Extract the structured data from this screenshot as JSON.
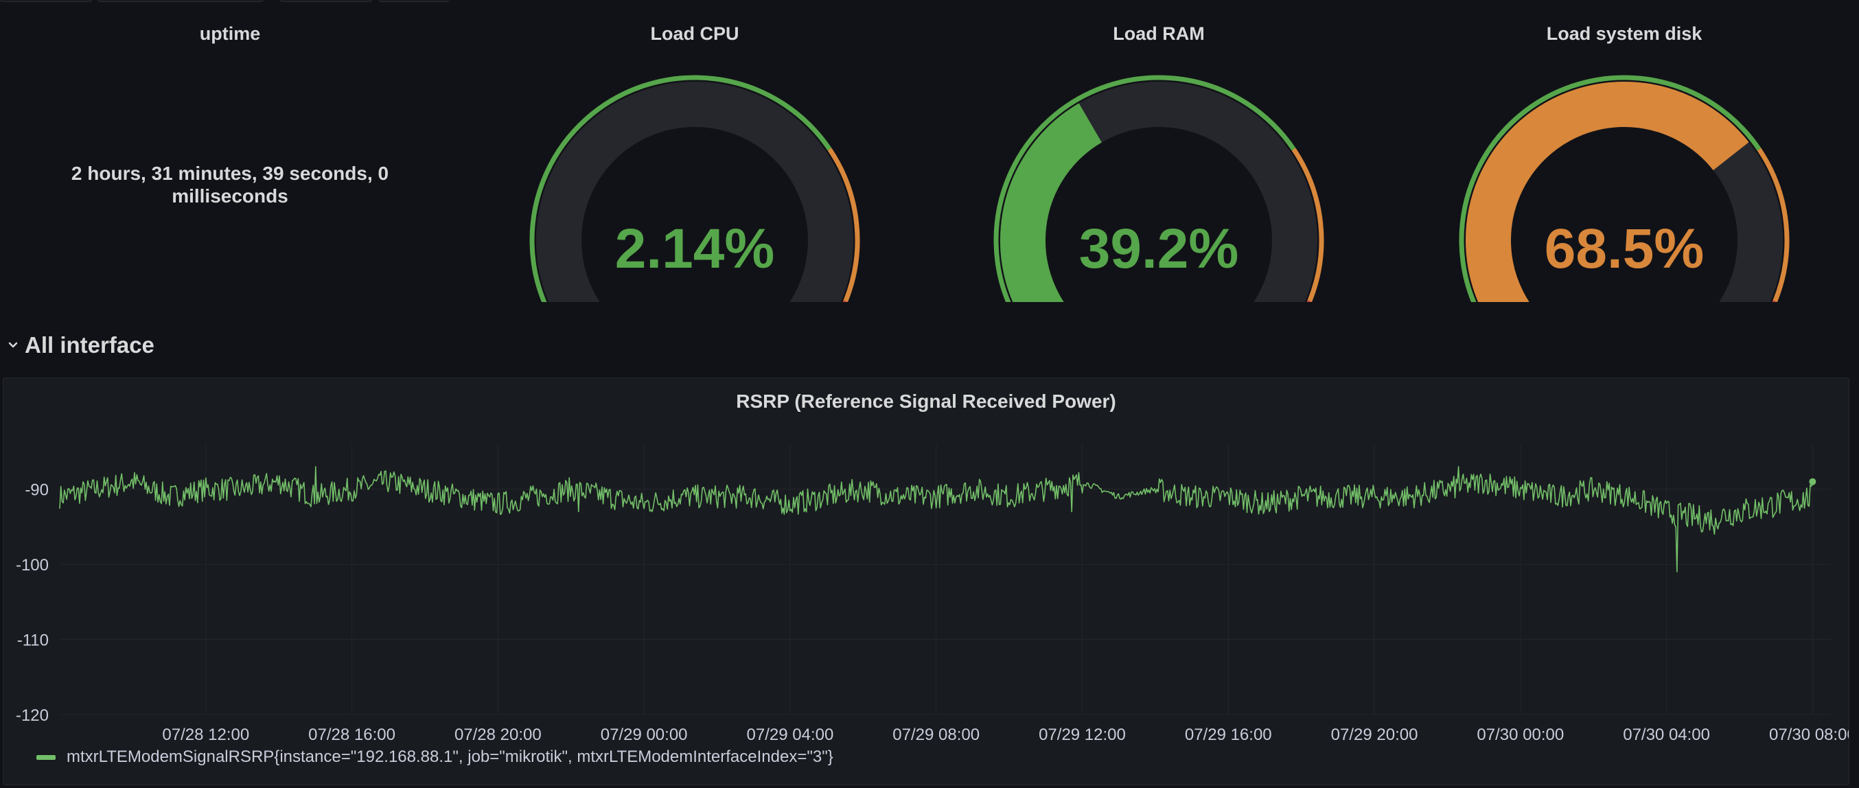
{
  "colors": {
    "background": "#111217",
    "panel": "#181b1f",
    "green": "#56a64b",
    "orange": "#d8873b",
    "red": "#c4413e",
    "series": "#73bf69"
  },
  "uptime": {
    "title": "uptime",
    "value": "2 hours, 31 minutes, 39 seconds, 0 milliseconds"
  },
  "gauges": [
    {
      "title": "Load CPU",
      "value": 2.14,
      "display": "2.14%",
      "color": "#56a64b"
    },
    {
      "title": "Load RAM",
      "value": 39.2,
      "display": "39.2%",
      "color": "#56a64b"
    },
    {
      "title": "Load system disk",
      "value": 68.5,
      "display": "68.5%",
      "color": "#d8873b"
    }
  ],
  "row": {
    "title": "All interface",
    "icon": "chevron-down-icon"
  },
  "chart_data": {
    "type": "line",
    "title": "RSRP (Reference Signal Received Power)",
    "x_ticks": [
      "07/28 12:00",
      "07/28 16:00",
      "07/28 20:00",
      "07/29 00:00",
      "07/29 04:00",
      "07/29 08:00",
      "07/29 12:00",
      "07/29 16:00",
      "07/29 20:00",
      "07/30 00:00",
      "07/30 04:00",
      "07/30 08:00"
    ],
    "y_ticks": [
      -90,
      -100,
      -110,
      -120
    ],
    "ylim": [
      -120,
      -84
    ],
    "grid": true,
    "legend_position": "bottom-left",
    "series": [
      {
        "name": "mtxrLTEModemSignalRSRP{instance=\"192.168.88.1\", job=\"mikrotik\", mtxrLTEModemInterfaceIndex=\"3\"}",
        "color": "#73bf69",
        "x_hours": [
          0,
          1,
          2,
          3,
          4,
          5,
          6,
          7,
          8,
          9,
          10,
          11,
          12,
          13,
          14,
          15,
          16,
          17,
          18,
          19,
          20,
          21,
          22,
          23,
          24,
          25,
          26,
          27,
          28,
          29,
          30,
          31,
          32,
          33,
          34,
          35,
          36,
          37,
          38,
          39,
          40,
          41,
          42,
          43,
          44,
          45,
          46,
          47,
          48
        ],
        "values": [
          -91,
          -90,
          -89,
          -91,
          -90,
          -90,
          -89,
          -91,
          -90,
          -89,
          -90,
          -91,
          -92,
          -91,
          -90,
          -91,
          -92,
          -91,
          -91,
          -91,
          -92,
          -91,
          -90,
          -91,
          -91,
          -90,
          -91,
          -90,
          -89,
          -91,
          -90,
          -91,
          -91,
          -92,
          -91,
          -91,
          -91,
          -91,
          -90,
          -89,
          -90,
          -91,
          -90,
          -91,
          -93,
          -94,
          -93,
          -92,
          -91
        ]
      }
    ],
    "spikes": [
      {
        "x_hour": 7.0,
        "value": -87
      },
      {
        "x_hour": 14.2,
        "value": -93
      },
      {
        "x_hour": 27.7,
        "value": -93
      },
      {
        "x_hour": 38.3,
        "value": -87
      },
      {
        "x_hour": 44.3,
        "value": -101
      },
      {
        "x_hour": 45.3,
        "value": -96
      }
    ]
  }
}
